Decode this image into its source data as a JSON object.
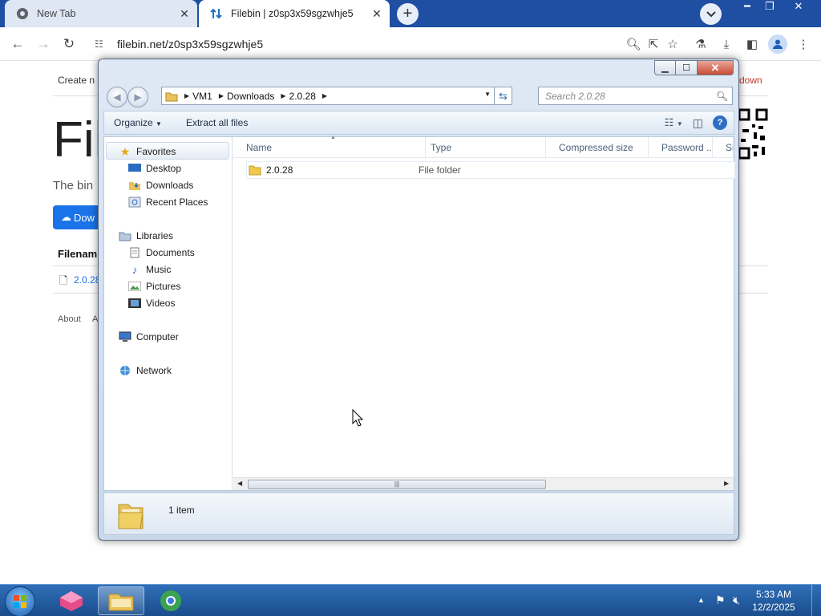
{
  "browser": {
    "tabs": [
      {
        "title": "New Tab"
      },
      {
        "title": "Filebin | z0sp3x59sgzwhje5"
      }
    ],
    "url": "filebin.net/z0sp3x59sgzwhje5"
  },
  "page": {
    "create_link": "Create n",
    "heading_partial": "Fil",
    "intro_partial": "The bin",
    "download_btn_partial": "Dow",
    "filename_header_partial": "Filenam",
    "file_link_partial": "2.0.28",
    "footer_about": "About",
    "footer_partial": "A",
    "right_link_partial": "down"
  },
  "explorer": {
    "breadcrumb": [
      "VM1",
      "Downloads",
      "2.0.28"
    ],
    "search_placeholder": "Search 2.0.28",
    "commands": {
      "organize": "Organize",
      "extract": "Extract all files"
    },
    "nav": {
      "favorites": "Favorites",
      "desktop": "Desktop",
      "downloads": "Downloads",
      "recent": "Recent Places",
      "libraries": "Libraries",
      "documents": "Documents",
      "music": "Music",
      "pictures": "Pictures",
      "videos": "Videos",
      "computer": "Computer",
      "network": "Network"
    },
    "columns": {
      "name": "Name",
      "type": "Type",
      "compressed": "Compressed size",
      "password": "Password ...",
      "size": "Si"
    },
    "files": [
      {
        "name": "2.0.28",
        "type": "File folder"
      }
    ],
    "status": "1 item"
  },
  "taskbar": {
    "time": "5:33 AM",
    "date": "12/2/2025"
  }
}
